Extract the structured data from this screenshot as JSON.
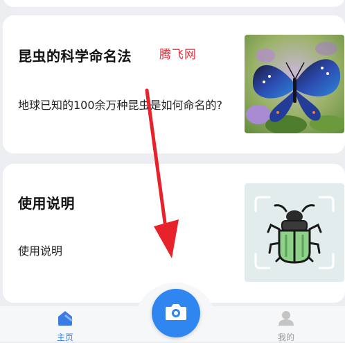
{
  "cards": [
    {
      "title": "昆虫的科学命名法",
      "desc": "地球已知的100余万种昆虫是如何命名的?",
      "watermark": "腾飞网",
      "image": "butterfly-photo"
    },
    {
      "title": "使用说明",
      "desc": "使用说明",
      "image": "beetle-scan-icon"
    }
  ],
  "tabbar": {
    "home": {
      "label": "主页",
      "icon": "home-icon"
    },
    "camera": {
      "icon": "camera-icon"
    },
    "me": {
      "label": "我的",
      "icon": "user-icon"
    }
  },
  "colors": {
    "accent": "#2f86f0",
    "tab_active": "#3a7be6",
    "tab_inactive": "#999999",
    "annotation_arrow": "#e8222a"
  }
}
